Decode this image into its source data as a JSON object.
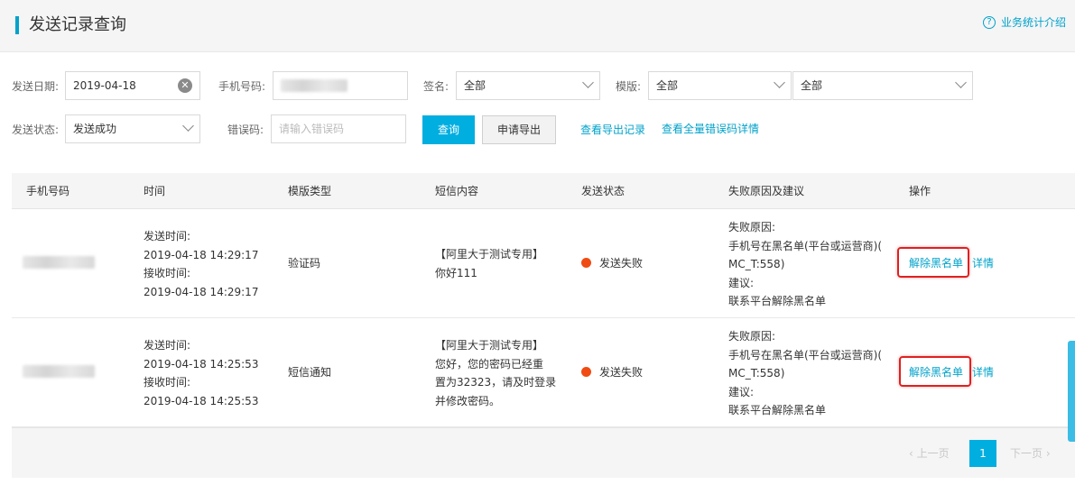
{
  "header": {
    "title": "发送记录查询",
    "help_label": "业务统计介绍",
    "help_icon": "question-circle-icon"
  },
  "filters": {
    "send_date_label": "发送日期:",
    "send_date_value": "2019-04-18",
    "phone_label": "手机号码:",
    "sign_label": "签名:",
    "sign_value": "全部",
    "template_label": "模版:",
    "template_value": "全部",
    "template_value2": "全部",
    "send_status_label": "发送状态:",
    "send_status_value": "发送成功",
    "error_code_label": "错误码:",
    "error_code_placeholder": "请输入错误码",
    "query_button": "查询",
    "export_button": "申请导出",
    "view_export_link": "查看导出记录",
    "view_errors_link": "查看全量错误码详情"
  },
  "table": {
    "columns": [
      "手机号码",
      "时间",
      "模版类型",
      "短信内容",
      "发送状态",
      "失败原因及建议",
      "操作"
    ],
    "rows": [
      {
        "send_time_label": "发送时间:",
        "send_time": "2019-04-18 14:29:17",
        "recv_time_label": "接收时间:",
        "recv_time": "2019-04-18 14:29:17",
        "template_type": "验证码",
        "content_lines": [
          "【阿里大于测试专用】",
          "你好111"
        ],
        "status": "发送失败",
        "reason_label": "失败原因:",
        "reason_lines": [
          "手机号在黑名单(平台或运营商)(",
          "MC_T:558)"
        ],
        "advice_label": "建议:",
        "advice": "联系平台解除黑名单",
        "op_unblock": "解除黑名单",
        "op_detail": "详情"
      },
      {
        "send_time_label": "发送时间:",
        "send_time": "2019-04-18 14:25:53",
        "recv_time_label": "接收时间:",
        "recv_time": "2019-04-18 14:25:53",
        "template_type": "短信通知",
        "content_lines": [
          "【阿里大于测试专用】",
          "您好，您的密码已经重",
          "置为32323，请及时登录",
          "并修改密码。"
        ],
        "status": "发送失败",
        "reason_label": "失败原因:",
        "reason_lines": [
          "手机号在黑名单(平台或运营商)(",
          "MC_T:558)"
        ],
        "advice_label": "建议:",
        "advice": "联系平台解除黑名单",
        "op_unblock": "解除黑名单",
        "op_detail": "详情"
      }
    ]
  },
  "pagination": {
    "prev": "上一页",
    "current": "1",
    "next": "下一页"
  },
  "colors": {
    "accent": "#00a2ca",
    "primary_button": "#00aee0",
    "fail_dot": "#f04b12",
    "highlight_box": "#e02020"
  }
}
